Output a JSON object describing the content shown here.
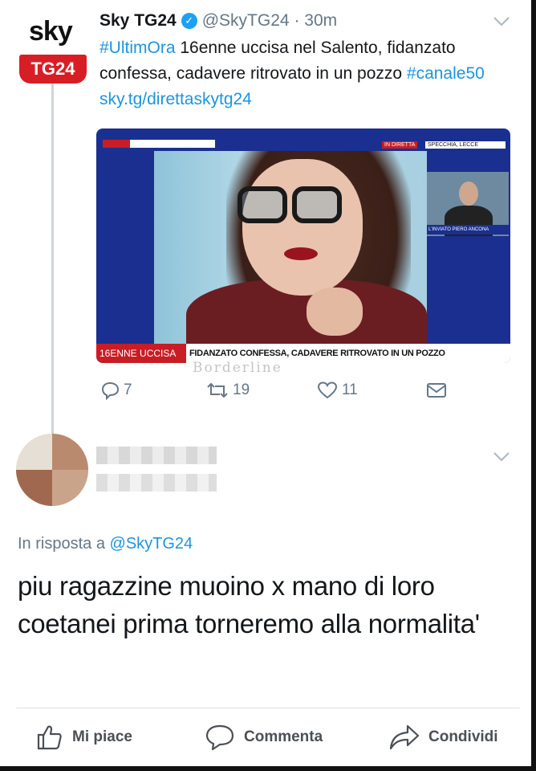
{
  "tweet": {
    "avatar": {
      "logo_top": "sky",
      "logo_bottom": "TG24",
      "brand_color": "#d81e25"
    },
    "name": "Sky TG24",
    "handle": "@SkyTG24",
    "separator": "·",
    "time": "30m",
    "text": {
      "hashtag1": "#UltimOra",
      "body": " 16enne uccisa nel Salento, fidanzato confessa, cadavere ritrovato in un pozzo ",
      "hashtag2": "#canale50",
      "link": "sky.tg/direttaskytg24"
    },
    "media": {
      "live_tag": "IN DIRETTA",
      "live_place": "SPECCHIA, LECCE",
      "inset_caption": "L'INVIATO PIERO ANCONA",
      "lower_third_red": "16ENNE UCCISA",
      "lower_third_caption": "FIDANZATO CONFESSA, CADAVERE RITROVATO IN UN POZZO"
    },
    "watermark": "Borderline",
    "actions": {
      "replies": "7",
      "retweets": "19",
      "likes": "11"
    },
    "link_color": "#1b95e0"
  },
  "reply": {
    "in_reply_to_prefix": "In risposta a",
    "in_reply_to_handle": "@SkyTG24",
    "text": "piu ragazzine muoino x mano di loro coetanei prima torneremo alla normalita'"
  },
  "facebook_bar": {
    "like": "Mi piace",
    "comment": "Commenta",
    "share": "Condividi"
  }
}
